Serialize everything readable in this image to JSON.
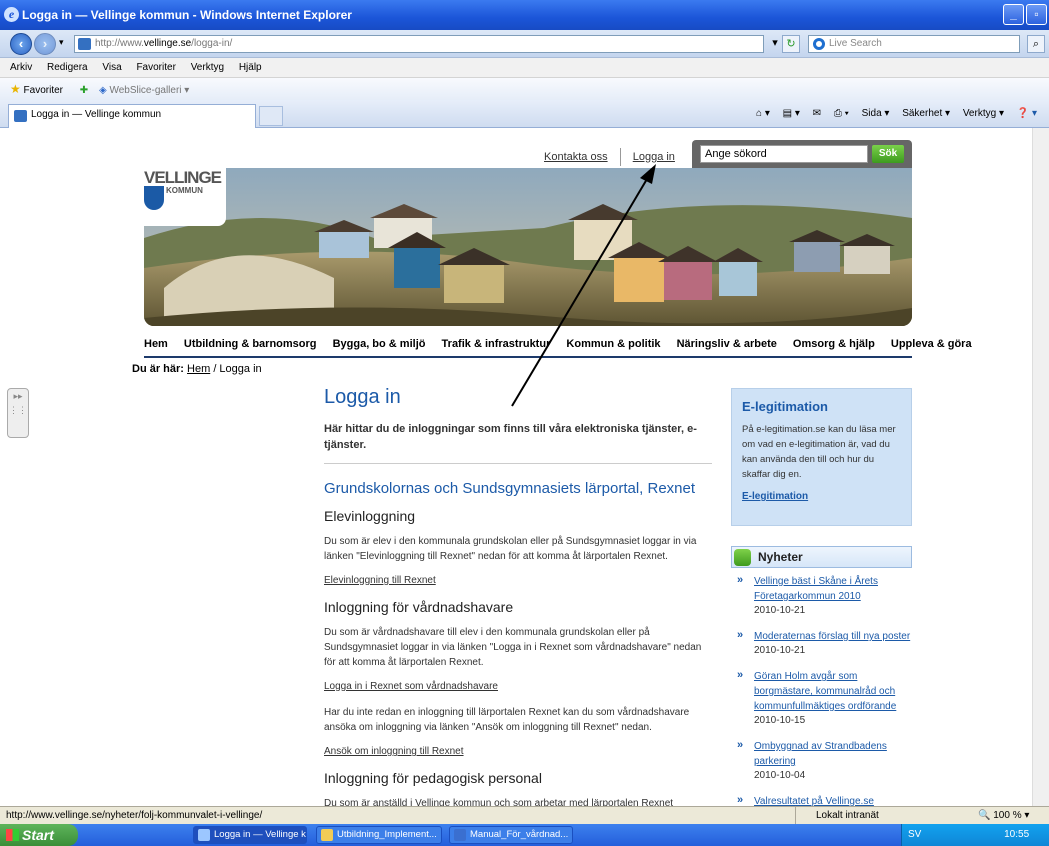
{
  "window": {
    "title": "Logga in — Vellinge kommun - Windows Internet Explorer"
  },
  "address": {
    "url_prefix": "http://www.",
    "url_domain": "vellinge.se",
    "url_path": "/logga-in/",
    "search_placeholder": "Live Search"
  },
  "menu": [
    "Arkiv",
    "Redigera",
    "Visa",
    "Favoriter",
    "Verktyg",
    "Hjälp"
  ],
  "favorites": {
    "label": "Favoriter",
    "webslice": "WebSlice-galleri ▾"
  },
  "tab": {
    "label": "Logga in — Vellinge kommun"
  },
  "commandbar": {
    "page": "Sida ▾",
    "safety": "Säkerhet ▾",
    "tools": "Verktyg ▾"
  },
  "site": {
    "logo": {
      "name": "VELLINGE",
      "sub": "KOMMUN"
    },
    "util_links": {
      "contact": "Kontakta oss",
      "login": "Logga in"
    },
    "search": {
      "placeholder": "Ange sökord",
      "button": "Sök"
    },
    "main_nav": [
      "Hem",
      "Utbildning & barnomsorg",
      "Bygga, bo & miljö",
      "Trafik & infrastruktur",
      "Kommun & politik",
      "Näringsliv & arbete",
      "Omsorg & hjälp",
      "Uppleva & göra"
    ],
    "breadcrumb": {
      "prefix": "Du är här:",
      "home": "Hem",
      "current": " / Logga in"
    }
  },
  "content": {
    "title": "Logga in",
    "intro": "Här hittar du de inloggningar som finns till våra elektroniska tjänster, e-tjänster.",
    "section_title": "Grundskolornas och Sundsgymnasiets lärportal, Rexnet",
    "student": {
      "heading": "Elevinloggning",
      "text": "Du som är elev i den kommunala grundskolan eller på Sundsgymnasiet loggar in via länken \"Elevinloggning till Rexnet\" nedan för att komma åt lärportalen Rexnet.",
      "link": "Elevinloggning till Rexnet"
    },
    "guardian": {
      "heading": "Inloggning för vårdnadshavare",
      "text": "Du som är vårdnadshavare till elev i den kommunala grundskolan eller på Sundsgymnasiet loggar in via länken \"Logga in i Rexnet som vårdnadshavare\" nedan för att komma åt lärportalen Rexnet.",
      "link": "Logga in i Rexnet som vårdnadshavare",
      "text2": "Har du inte redan en inloggning till lärportalen Rexnet kan du som vårdnadshavare ansöka om inloggning via länken \"Ansök om inloggning till Rexnet\" nedan.",
      "link2": "Ansök om inloggning till Rexnet"
    },
    "staff": {
      "heading": "Inloggning för pedagogisk personal",
      "text": "Du som är anställd i Vellinge kommun och som arbetar med lärportalen Rexnet"
    }
  },
  "sidebar": {
    "eleg": {
      "title": "E-legitimation",
      "text": "På e-legitimation.se kan du läsa mer om vad en e-legitimation är, vad du kan använda den till och hur du skaffar dig en.",
      "link": "E-legitimation"
    },
    "news_title": "Nyheter",
    "news": [
      {
        "title": "Vellinge bäst i Skåne i Årets Företagarkommun 2010",
        "date": "2010-10-21"
      },
      {
        "title": "Moderaternas förslag till nya poster",
        "date": "2010-10-21"
      },
      {
        "title": "Göran Holm avgår som borgmästare, kommunalråd och kommunfullmäktiges ordförande",
        "date": "2010-10-15"
      },
      {
        "title": "Ombyggnad av Strandbadens parkering",
        "date": "2010-10-04"
      },
      {
        "title": "Valresultatet på Vellinge.se",
        "date": ""
      }
    ]
  },
  "status": {
    "url": "http://www.vellinge.se/nyheter/folj-kommunvalet-i-vellinge/",
    "zone": "Lokalt intranät",
    "zoom": "100 %"
  },
  "taskbar": {
    "start": "Start",
    "items": [
      "Logga in — Vellinge k...",
      "Utbildning_Implement...",
      "Manual_För_vårdnad..."
    ],
    "lang": "SV",
    "time": "10:55"
  }
}
